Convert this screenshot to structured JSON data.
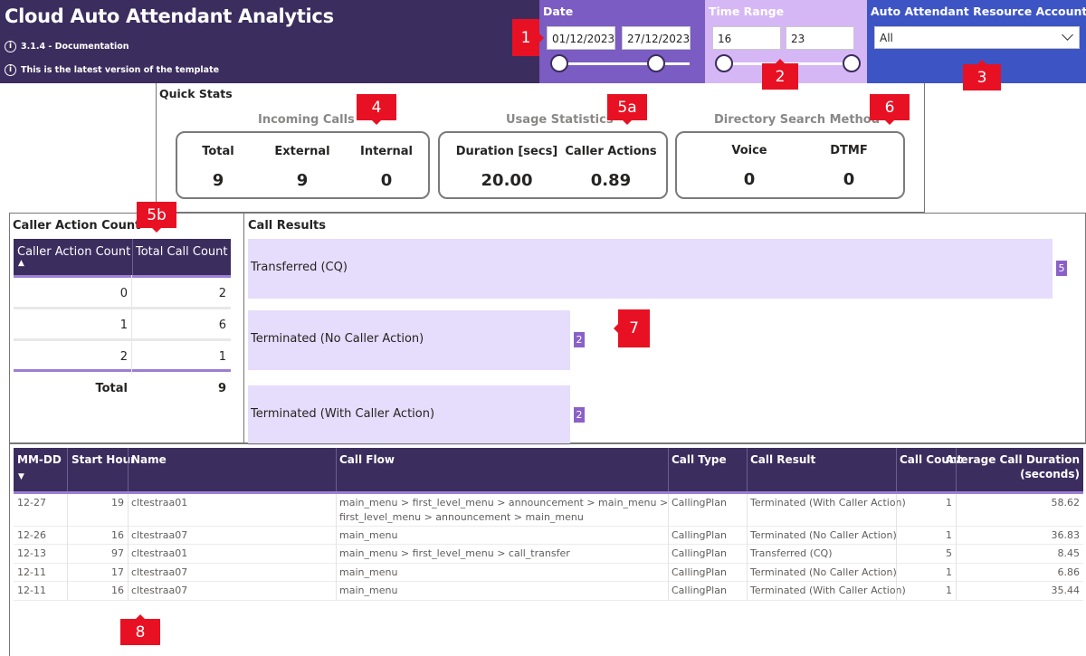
{
  "header": {
    "title": "Cloud Auto Attendant Analytics",
    "version_text": "3.1.4 - Documentation",
    "latest_text": "This is the latest version of the template",
    "info_glyph": "i"
  },
  "filters": {
    "date": {
      "title": "Date",
      "start": "01/12/2023",
      "end": "27/12/2023"
    },
    "time_range": {
      "title": "Time Range",
      "start": "16",
      "end": "23"
    },
    "accounts": {
      "title": "Auto Attendant Resource Accounts",
      "selected": "All"
    }
  },
  "callouts": [
    "1",
    "2",
    "3",
    "4",
    "5a",
    "6",
    "5b",
    "7",
    "8"
  ],
  "quick_stats": {
    "title": "Quick Stats",
    "incoming_calls": {
      "title": "Incoming Calls",
      "total_label": "Total",
      "total": "9",
      "external_label": "External",
      "external": "9",
      "internal_label": "Internal",
      "internal": "0"
    },
    "usage_statistics": {
      "title": "Usage Statistics",
      "duration_label": "Duration [secs]",
      "duration": "20.00",
      "caller_actions_label": "Caller Actions",
      "caller_actions": "0.89"
    },
    "directory_search": {
      "title": "Directory Search Method",
      "voice_label": "Voice",
      "voice": "0",
      "dtmf_label": "DTMF",
      "dtmf": "0"
    }
  },
  "caller_action_table": {
    "title": "Caller Action Count",
    "columns": [
      "Caller Action Count",
      "Total Call Count"
    ],
    "sort_glyph": "▲",
    "rows": [
      {
        "count": "0",
        "total": "2"
      },
      {
        "count": "1",
        "total": "6"
      },
      {
        "count": "2",
        "total": "1"
      }
    ],
    "total_label": "Total",
    "total_value": "9"
  },
  "call_results": {
    "title": "Call Results",
    "bars": [
      {
        "label": "Transferred (CQ)",
        "value": 5
      },
      {
        "label": "Terminated (No Caller Action)",
        "value": 2
      },
      {
        "label": "Terminated (With Caller Action)",
        "value": 2
      }
    ],
    "max": 5
  },
  "detail_table": {
    "columns": [
      "MM-DD",
      "Start Hour",
      "Name",
      "Call Flow",
      "Call Type",
      "Call Result",
      "Call Count",
      "Average Call Duration",
      "(seconds)"
    ],
    "sort_glyph": "▼",
    "rows": [
      {
        "mmdd": "12-27",
        "hour": "19",
        "name": "cltestraa01",
        "flow1": "main_menu > first_level_menu > announcement > main_menu >",
        "flow2": "first_level_menu > announcement > main_menu",
        "type": "CallingPlan",
        "result": "Terminated (With Caller Action)",
        "count": "1",
        "avg": "58.62"
      },
      {
        "mmdd": "12-26",
        "hour": "16",
        "name": "cltestraa07",
        "flow1": "main_menu",
        "flow2": "",
        "type": "CallingPlan",
        "result": "Terminated (No Caller Action)",
        "count": "1",
        "avg": "36.83"
      },
      {
        "mmdd": "12-13",
        "hour": "97",
        "name": "cltestraa01",
        "flow1": "main_menu > first_level_menu > call_transfer",
        "flow2": "",
        "type": "CallingPlan",
        "result": "Transferred (CQ)",
        "count": "5",
        "avg": "8.45"
      },
      {
        "mmdd": "12-11",
        "hour": "17",
        "name": "cltestraa07",
        "flow1": "main_menu",
        "flow2": "",
        "type": "CallingPlan",
        "result": "Terminated (No Caller Action)",
        "count": "1",
        "avg": "6.86"
      },
      {
        "mmdd": "12-11",
        "hour": "16",
        "name": "cltestraa07",
        "flow1": "main_menu",
        "flow2": "",
        "type": "CallingPlan",
        "result": "Terminated (With Caller Action)",
        "count": "1",
        "avg": "35.44"
      }
    ]
  },
  "colors": {
    "header_bg": "#3b2d5e",
    "date_panel": "#7a5cc2",
    "time_panel": "#d6b7f5",
    "accounts_panel": "#3d55c4",
    "bar_fill": "#e6dcfb",
    "bar_value_badge": "#8a61c9",
    "callout": "#e81123"
  }
}
